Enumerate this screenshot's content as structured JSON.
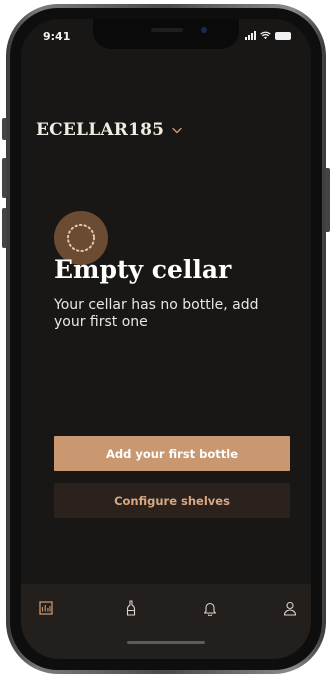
{
  "status_bar": {
    "time": "9:41"
  },
  "header": {
    "cellar_name": "ECELLAR185",
    "dropdown_icon": "chevron-down-icon"
  },
  "empty_state": {
    "icon": "dotted-circle-icon",
    "title": "Empty cellar",
    "description": "Your cellar has no bottle, add your first one"
  },
  "actions": {
    "primary_label": "Add your first bottle",
    "secondary_label": "Configure shelves"
  },
  "tab_bar": {
    "items": [
      {
        "id": "cellar",
        "icon": "cellar-icon",
        "active": true
      },
      {
        "id": "bottles",
        "icon": "bottle-icon",
        "active": false
      },
      {
        "id": "notifications",
        "icon": "bell-icon",
        "active": false
      },
      {
        "id": "profile",
        "icon": "user-icon",
        "active": false
      }
    ]
  },
  "colors": {
    "background": "#191716",
    "accent": "#c99770",
    "secondary_button": "#2b211d",
    "badge": "#6b4b32"
  }
}
